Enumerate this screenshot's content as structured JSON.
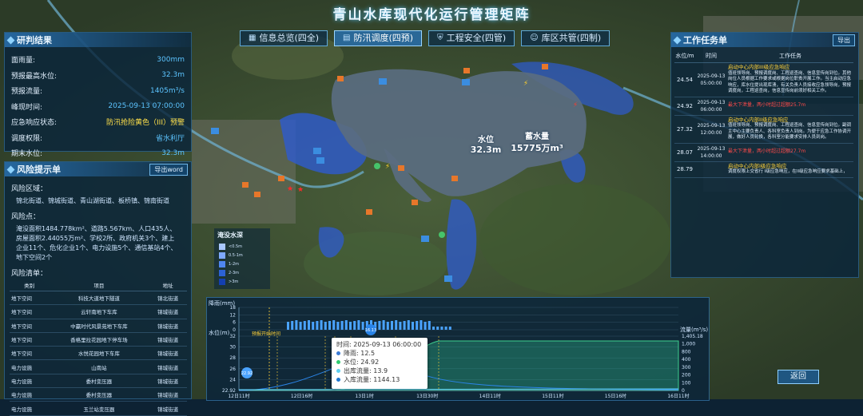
{
  "header": {
    "title": "青山水库现代化运行管理矩阵"
  },
  "tabs": [
    {
      "label": "信息总览(四全)",
      "icon": "grid-icon",
      "active": false
    },
    {
      "label": "防汛调度(四预)",
      "icon": "document-icon",
      "active": true
    },
    {
      "label": "工程安全(四管)",
      "icon": "shield-icon",
      "active": false
    },
    {
      "label": "库区共管(四制)",
      "icon": "person-icon",
      "active": false
    }
  ],
  "research": {
    "title": "研判结果",
    "rows": [
      {
        "k": "面雨量:",
        "v": "300mm"
      },
      {
        "k": "预报最高水位:",
        "v": "32.3m"
      },
      {
        "k": "预报流量:",
        "v": "1405m³/s"
      },
      {
        "k": "峰现时间:",
        "v": "2025-09-13 07:00:00"
      },
      {
        "k": "应急响应状态:",
        "v": "防汛抢险黄色（III）预警",
        "warn": true
      },
      {
        "k": "调度权限:",
        "v": "省水利厅"
      },
      {
        "k": "期末水位:",
        "v": "32.3m"
      }
    ]
  },
  "risk": {
    "title": "风险提示单",
    "export_label": "导出word",
    "area_label": "风险区域：",
    "area_text": "锦北街道、锦城街道、青山湖街道、板桥镇、锦南街道",
    "point_label": "风险点：",
    "point_text": "淹没面积1484.778km²、道路5.567km、人口435人、房屋面积2.44055万m²、学校2所、政府机关3个、建上企业11个、危化企业1个、电力设施5个、通信基站4个、地下空间2个",
    "list_label": "风险清单：",
    "columns": [
      "类别",
      "项目",
      "地址"
    ],
    "rows": [
      [
        "地下空间",
        "科技大道地下隧道",
        "锦北街道"
      ],
      [
        "地下空间",
        "云轩南地下车库",
        "锦城街道"
      ],
      [
        "地下空间",
        "中赢时代风景苑地下车库",
        "锦城街道"
      ],
      [
        "地下空间",
        "香格里拉花园地下停车场",
        "锦城街道"
      ],
      [
        "地下空间",
        "水悦花园地下车库",
        "锦城街道"
      ],
      [
        "电力设施",
        "山南站",
        "锦城街道"
      ],
      [
        "电力设施",
        "委村变压器",
        "锦城街道"
      ],
      [
        "电力设施",
        "委村变压器",
        "锦城街道"
      ],
      [
        "电力设施",
        "玉兰站变压器",
        "锦城街道"
      ]
    ]
  },
  "tasks": {
    "title": "工作任务单",
    "export_label": "导出",
    "columns": [
      "水位/m",
      "时间",
      "工作任务"
    ],
    "rows": [
      {
        "level": "24.54",
        "time": "2025-09-13 05:00:00",
        "head": "启动中心内部III级应急响应",
        "body": "值班领导岗、预报调度岗、工程巡查岗、信息宣传岗到位。其他岗位人员根据工作要求或根据岗位职责开展工作。当主启动应急响应，库水位提出现库溃，有关负责人员接收应急领导岗，预报调度岗，工程巡查岗，信息宣传岗前须好相关工作。",
        "red": ""
      },
      {
        "level": "24.92",
        "time": "2025-09-13 06:00:00",
        "head": "",
        "body": "",
        "red": "最大下泄量，两小时超过超额25.7m"
      },
      {
        "level": "27.32",
        "time": "2025-09-13 12:00:00",
        "head": "启动中心内部II级应急响应",
        "body": "值班领导岗、预报调度岗、工程巡查岗、信息宣传岗到位。副调主中心主要负责人、各科室负责人到岗。为便于应急工作协调开展，做好人员轮换，各科室分能要求安排人员到岗。",
        "red": ""
      },
      {
        "level": "28.07",
        "time": "2025-09-13 14:00:00",
        "head": "",
        "body": "",
        "red": "最大下泄量，两小时超过超额27.7m"
      },
      {
        "level": "28.79",
        "time": "",
        "head": "启动中心内部I级应急响应",
        "body": "调度权限上交省行 I级应急响应，在II级应急响应要求基础上，",
        "red": ""
      }
    ]
  },
  "map": {
    "water_level_label": "水位",
    "water_level_value": "32.3m",
    "storage_label": "蓄水量",
    "storage_value": "15775万m³",
    "legend_title": "淹没水深",
    "legend_items": [
      {
        "label": "<0.5m",
        "color": "#a9c7ff"
      },
      {
        "label": "0.5-1m",
        "color": "#7ea9ff"
      },
      {
        "label": "1-2m",
        "color": "#4f86f0"
      },
      {
        "label": "2-3m",
        "color": "#2c62d6"
      },
      {
        "label": ">3m",
        "color": "#143fb0"
      }
    ]
  },
  "chart_data": {
    "type": "line",
    "y1label": "水位(m)",
    "y2label": "流量(m³/s)",
    "rain_label": "降雨(mm)",
    "x_ticks": [
      "12日11时",
      "12日16时",
      "13日1时",
      "13日30时",
      "14日11时",
      "15日11时",
      "15日16时",
      "16日11时"
    ],
    "y1_ticks": [
      "22.92",
      "24",
      "26",
      "28",
      "30",
      "32"
    ],
    "y2_ticks": [
      "0",
      "100",
      "200",
      "300",
      "400",
      "800",
      "1,000",
      "1,405.18"
    ],
    "rain_ticks": [
      "0",
      "6",
      "12",
      "18"
    ],
    "forecast_label": "预报开始时间",
    "rain_peak_label": "16.13",
    "start_marker": "22.92",
    "series": [
      {
        "name": "降雨",
        "color": "#6fb8ff"
      },
      {
        "name": "水位",
        "color": "#3ecf8e"
      },
      {
        "name": "出库流量",
        "color": "#5fd0f0"
      },
      {
        "name": "入库流量",
        "color": "#2a84e8"
      }
    ]
  },
  "tooltip": {
    "time": "时间: 2025-09-13 06:00:00",
    "rows": [
      {
        "k": "降雨:",
        "v": "12.5",
        "color": "#3a7bd5"
      },
      {
        "k": "水位:",
        "v": "24.92",
        "color": "#2ecc71"
      },
      {
        "k": "出库流量:",
        "v": "13.9",
        "color": "#5fd0f0"
      },
      {
        "k": "入库流量:",
        "v": "1144.13",
        "color": "#1f78d1"
      }
    ]
  },
  "back_label": "返回"
}
